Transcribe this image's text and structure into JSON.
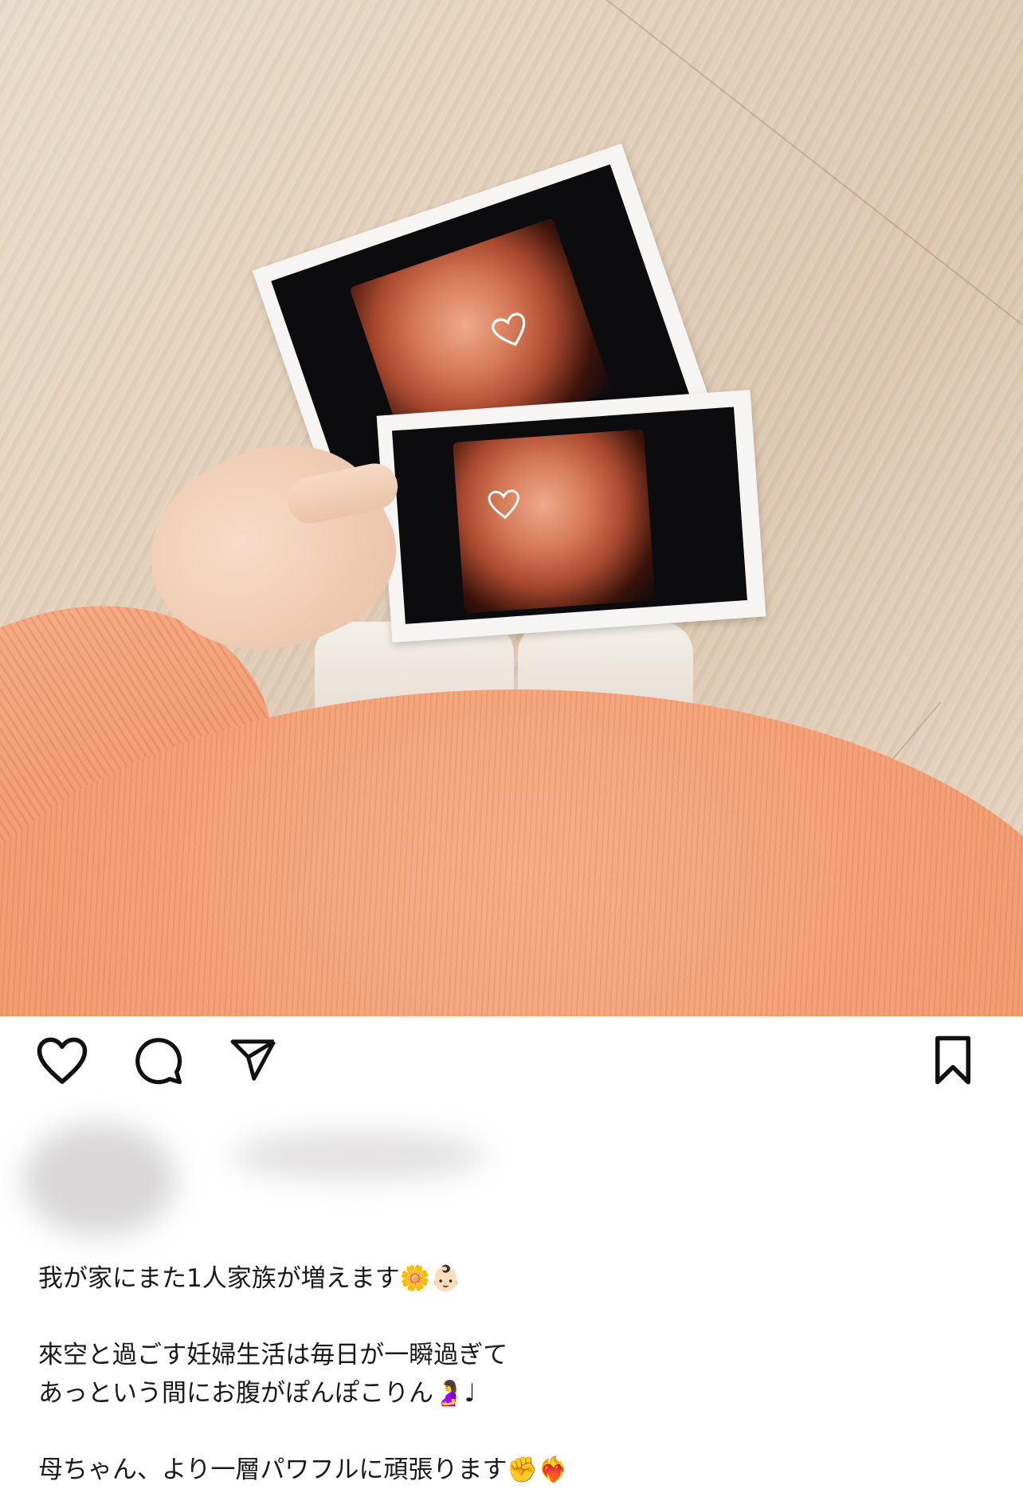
{
  "post": {
    "image_alt": "",
    "caption_lines": [
      "我が家にまた1人家族が増えます🌼👶🏻",
      "",
      "來空と過ごす妊婦生活は毎日が一瞬過ぎて",
      "あっという間にお腹がぽんぽこりん🤰♩",
      "",
      "母ちゃん、より一層パワフルに頑張ります✊❤️‍🔥"
    ]
  },
  "icons": {
    "like": "heart-icon",
    "comment": "comment-icon",
    "share": "send-icon",
    "save": "bookmark-icon"
  },
  "colors": {
    "icon": "#111111",
    "text": "#1a1a1a",
    "background": "#ffffff"
  }
}
